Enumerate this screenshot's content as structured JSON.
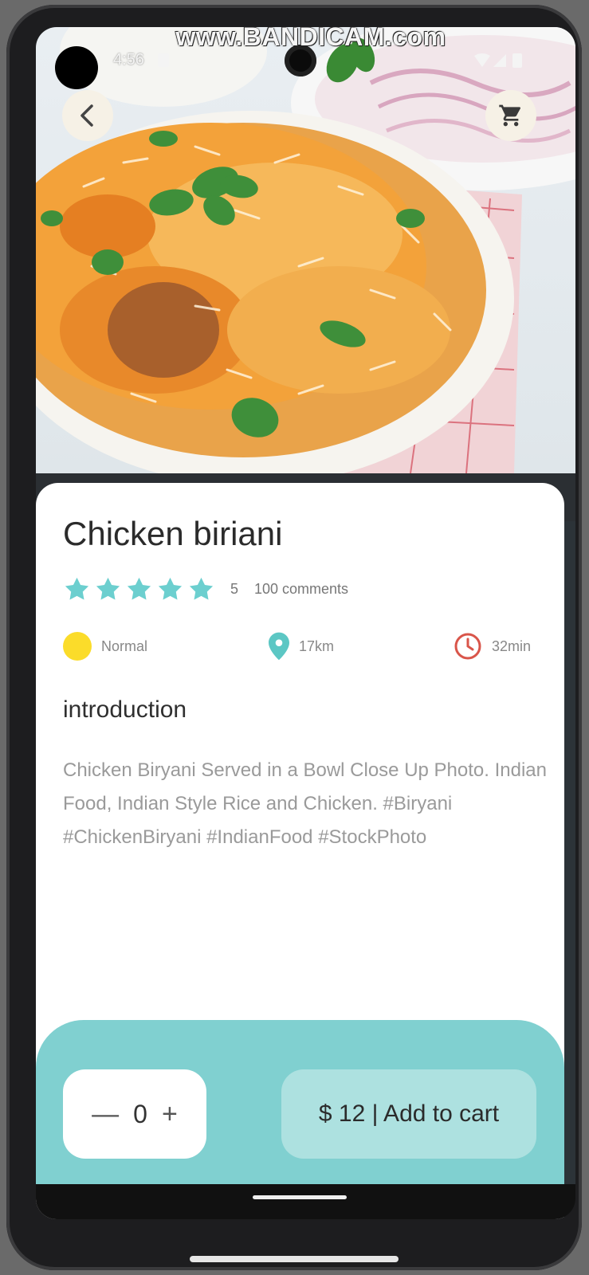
{
  "overlay": {
    "watermark": "www.BANDICAM.com"
  },
  "status_bar": {
    "time": "4:56"
  },
  "icons": {
    "back": "back-arrow-icon",
    "cart": "cart-icon",
    "star": "star-icon",
    "difficulty": "yellow-dot-icon",
    "distance": "location-pin-icon",
    "time": "clock-icon",
    "minus": "minus-icon",
    "plus": "plus-icon"
  },
  "colors": {
    "accent": "#80d0d0",
    "star": "#6ccfcf",
    "pin": "#5cc7c4",
    "clock": "#d9554a",
    "dot": "#fbdc2a",
    "add_button": "#ade1e0"
  },
  "product": {
    "title": "Chicken biriani",
    "rating": "5",
    "stars": 5,
    "comments": "100 comments",
    "difficulty": "Normal",
    "distance": "17km",
    "duration": "32min",
    "section_title": "introduction",
    "description": "Chicken Biryani Served in a Bowl Close Up Photo. Indian Food, Indian Style Rice and Chicken. #Biryani #ChickenBiryani #IndianFood #StockPhoto"
  },
  "cart": {
    "minus": "—",
    "quantity": "0",
    "plus": "+",
    "add_label": "$ 12 | Add to cart"
  }
}
